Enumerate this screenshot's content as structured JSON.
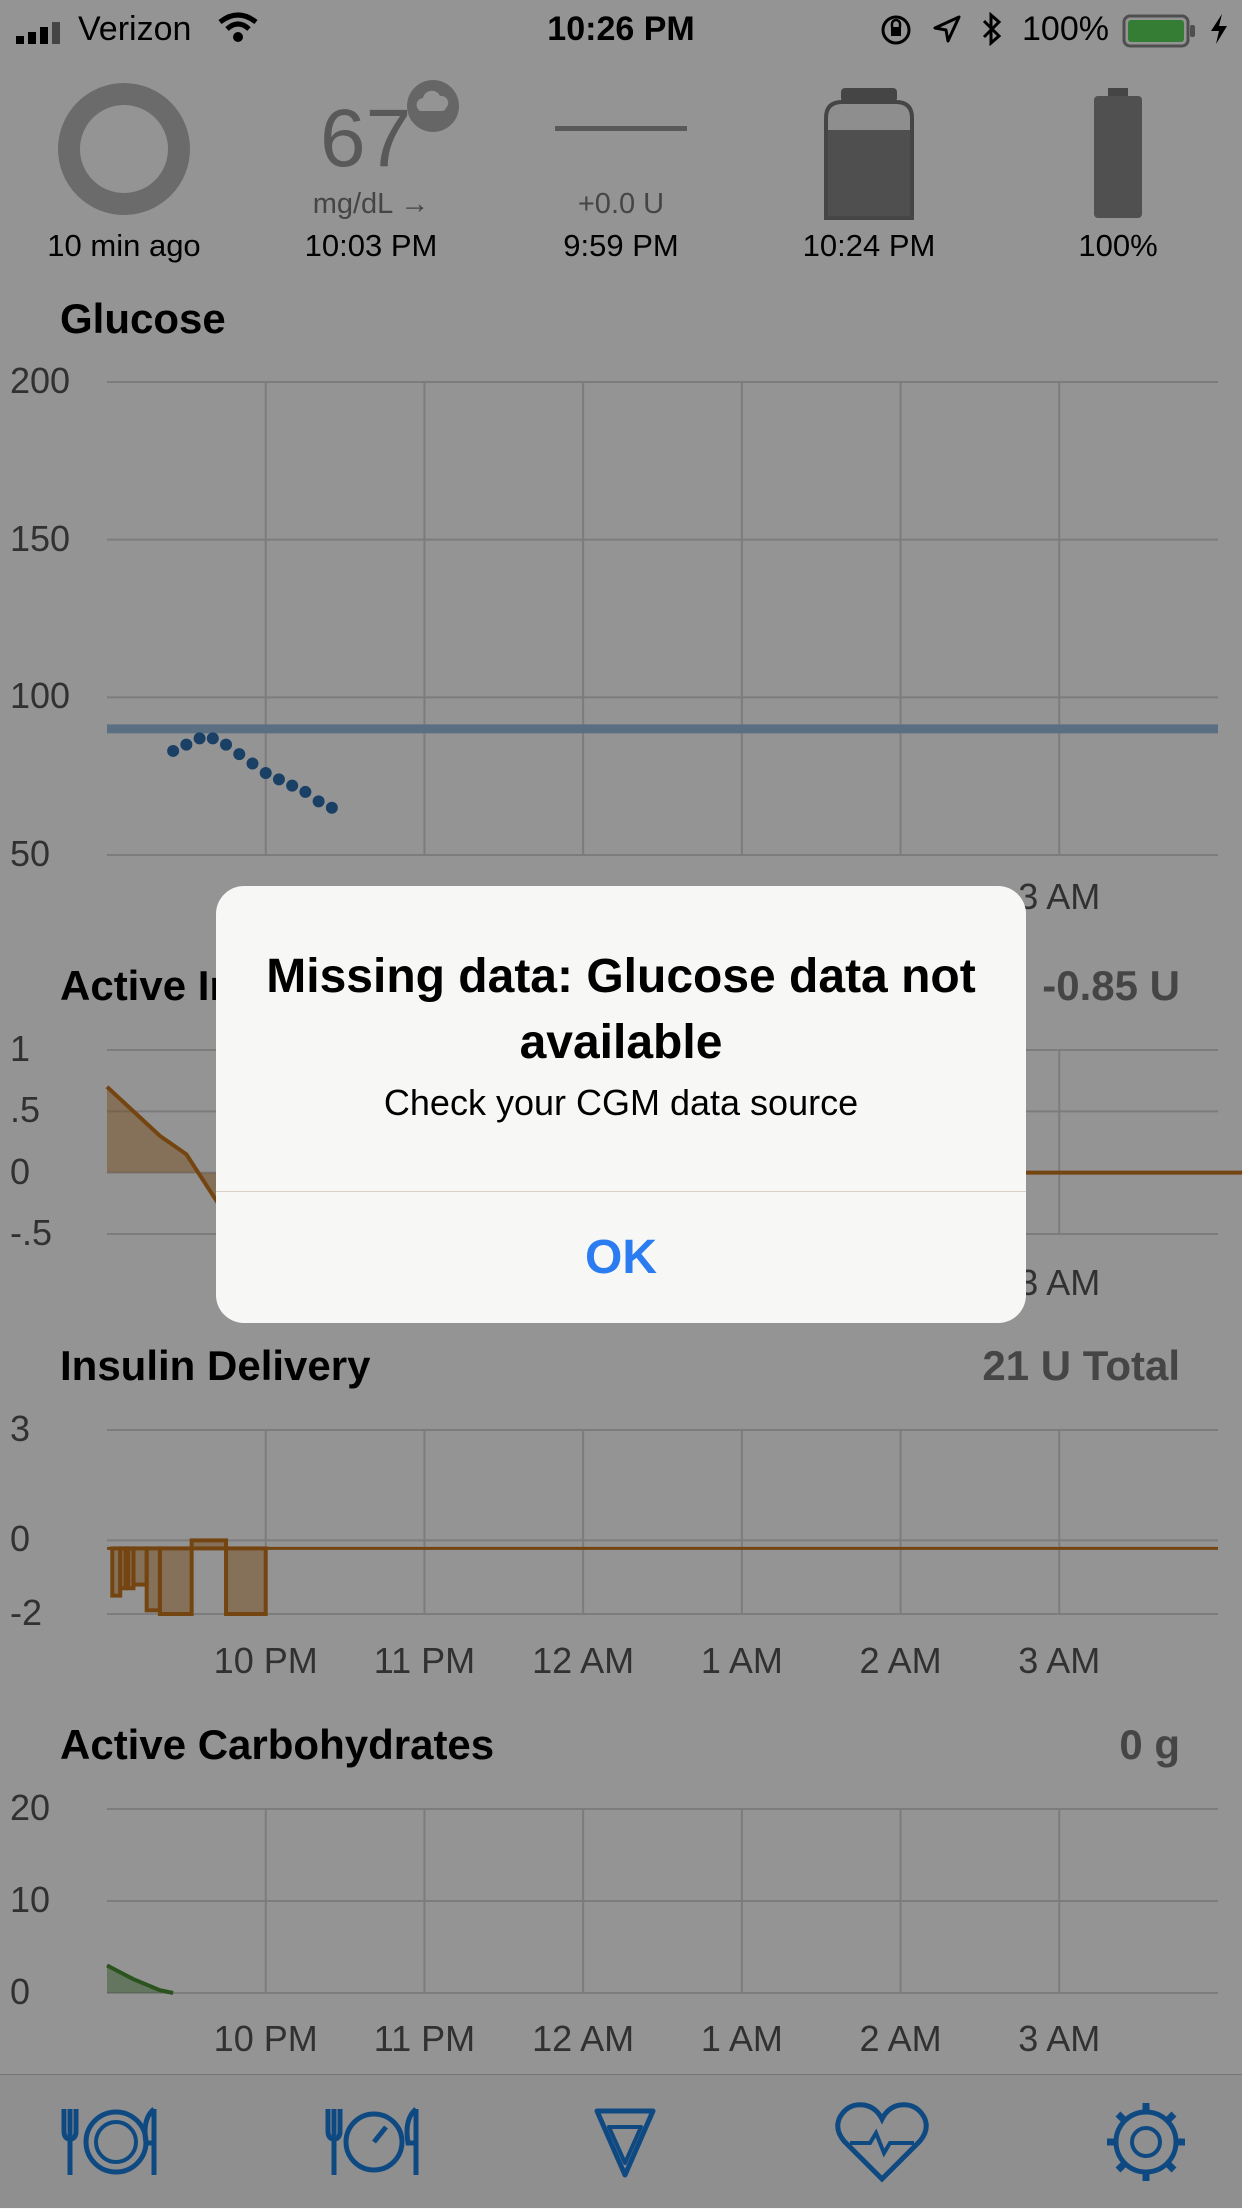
{
  "status_bar": {
    "carrier": "Verizon",
    "time": "10:26 PM",
    "battery_percent": "100%"
  },
  "hud": {
    "loop": {
      "caption": "10 min ago"
    },
    "glucose": {
      "value": "67",
      "unit_trend": "mg/dL →",
      "caption": "10:03 PM"
    },
    "basal": {
      "value": "+0.0 U",
      "caption": "9:59 PM"
    },
    "reservoir": {
      "caption": "10:24 PM"
    },
    "pump_battery": {
      "caption": "100%"
    }
  },
  "charts": {
    "glucose": {
      "title": "Glucose"
    },
    "active_insulin": {
      "title": "Active Insulin",
      "value": "-0.85 U"
    },
    "insulin_delivery": {
      "title": "Insulin Delivery",
      "value": "21 U Total"
    },
    "active_carbs": {
      "title": "Active Carbohydrates",
      "value": "0 g"
    }
  },
  "chart_data": [
    {
      "type": "scatter",
      "title": "Glucose",
      "ylim": [
        50,
        200
      ],
      "yticks": [
        "200",
        "150",
        "100",
        "50"
      ],
      "x_ticks": [
        "10 PM",
        "11 PM",
        "12 AM",
        "1 AM",
        "2 AM",
        "3 AM"
      ],
      "target_line": 90,
      "series": [
        {
          "x": [
            "9:25 PM",
            "9:30 PM",
            "9:35 PM",
            "9:40 PM",
            "9:45 PM",
            "9:50 PM",
            "9:55 PM",
            "10:00 PM",
            "10:05 PM",
            "10:10 PM",
            "10:15 PM",
            "10:20 PM",
            "10:25 PM"
          ],
          "y": [
            83,
            85,
            87,
            87,
            85,
            82,
            79,
            76,
            74,
            72,
            70,
            67,
            65
          ]
        }
      ],
      "series_color": "#2e6fb0",
      "target_color": "#9dc0e0"
    },
    {
      "type": "area",
      "title": "Active Insulin",
      "ylim": [
        -0.5,
        1
      ],
      "yticks": [
        "1",
        ".5",
        "0",
        "-.5"
      ],
      "x_ticks": [
        "10 PM",
        "11 PM",
        "12 AM",
        "1 AM",
        "2 AM",
        "3 AM"
      ],
      "series": [
        {
          "x": [
            "9:00 PM",
            "9:20 PM",
            "9:30 PM",
            "9:45 PM",
            "10:00 PM",
            "10:30 PM",
            "11:00 PM",
            "12:00 AM",
            "1:00 AM",
            "2:00 AM",
            "3:00 AM",
            "4:00 AM"
          ],
          "y": [
            0.7,
            0.3,
            0.15,
            -0.35,
            -0.45,
            -0.3,
            -0.2,
            -0.1,
            -0.05,
            0,
            0,
            0
          ]
        }
      ],
      "series_color": "#c8781e"
    },
    {
      "type": "bar",
      "title": "Insulin Delivery",
      "ylim": [
        -2,
        3
      ],
      "yticks": [
        "3",
        "0",
        "-2"
      ],
      "x_ticks": [
        "10 PM",
        "11 PM",
        "12 AM",
        "1 AM",
        "2 AM",
        "3 AM"
      ],
      "series": [
        {
          "x": [
            "9:02 PM",
            "9:05 PM",
            "9:07 PM",
            "9:08 PM",
            "9:10 PM",
            "9:15 PM",
            "9:20 PM",
            "9:32 PM",
            "9:45 PM"
          ],
          "y": [
            -1.5,
            -1.3,
            -1.1,
            -1.3,
            -1.2,
            -1.9,
            -2,
            0,
            -2
          ]
        }
      ],
      "series_color": "#c8781e"
    },
    {
      "type": "area",
      "title": "Active Carbohydrates",
      "ylim": [
        0,
        20
      ],
      "yticks": [
        "20",
        "10",
        "0"
      ],
      "x_ticks": [
        "10 PM",
        "11 PM",
        "12 AM",
        "1 AM",
        "2 AM",
        "3 AM"
      ],
      "series": [
        {
          "x": [
            "9:00 PM",
            "9:10 PM",
            "9:20 PM",
            "9:25 PM"
          ],
          "y": [
            3,
            1.5,
            0.3,
            0
          ]
        }
      ],
      "series_color": "#4a8f36"
    }
  ],
  "alert": {
    "title": "Missing data: Glucose data not available",
    "message": "Check your CGM data source",
    "ok_label": "OK"
  },
  "tab_bar": {
    "icons": [
      "carb-entry-icon",
      "bolus-icon",
      "temp-target-icon",
      "health-icon",
      "settings-icon"
    ]
  }
}
